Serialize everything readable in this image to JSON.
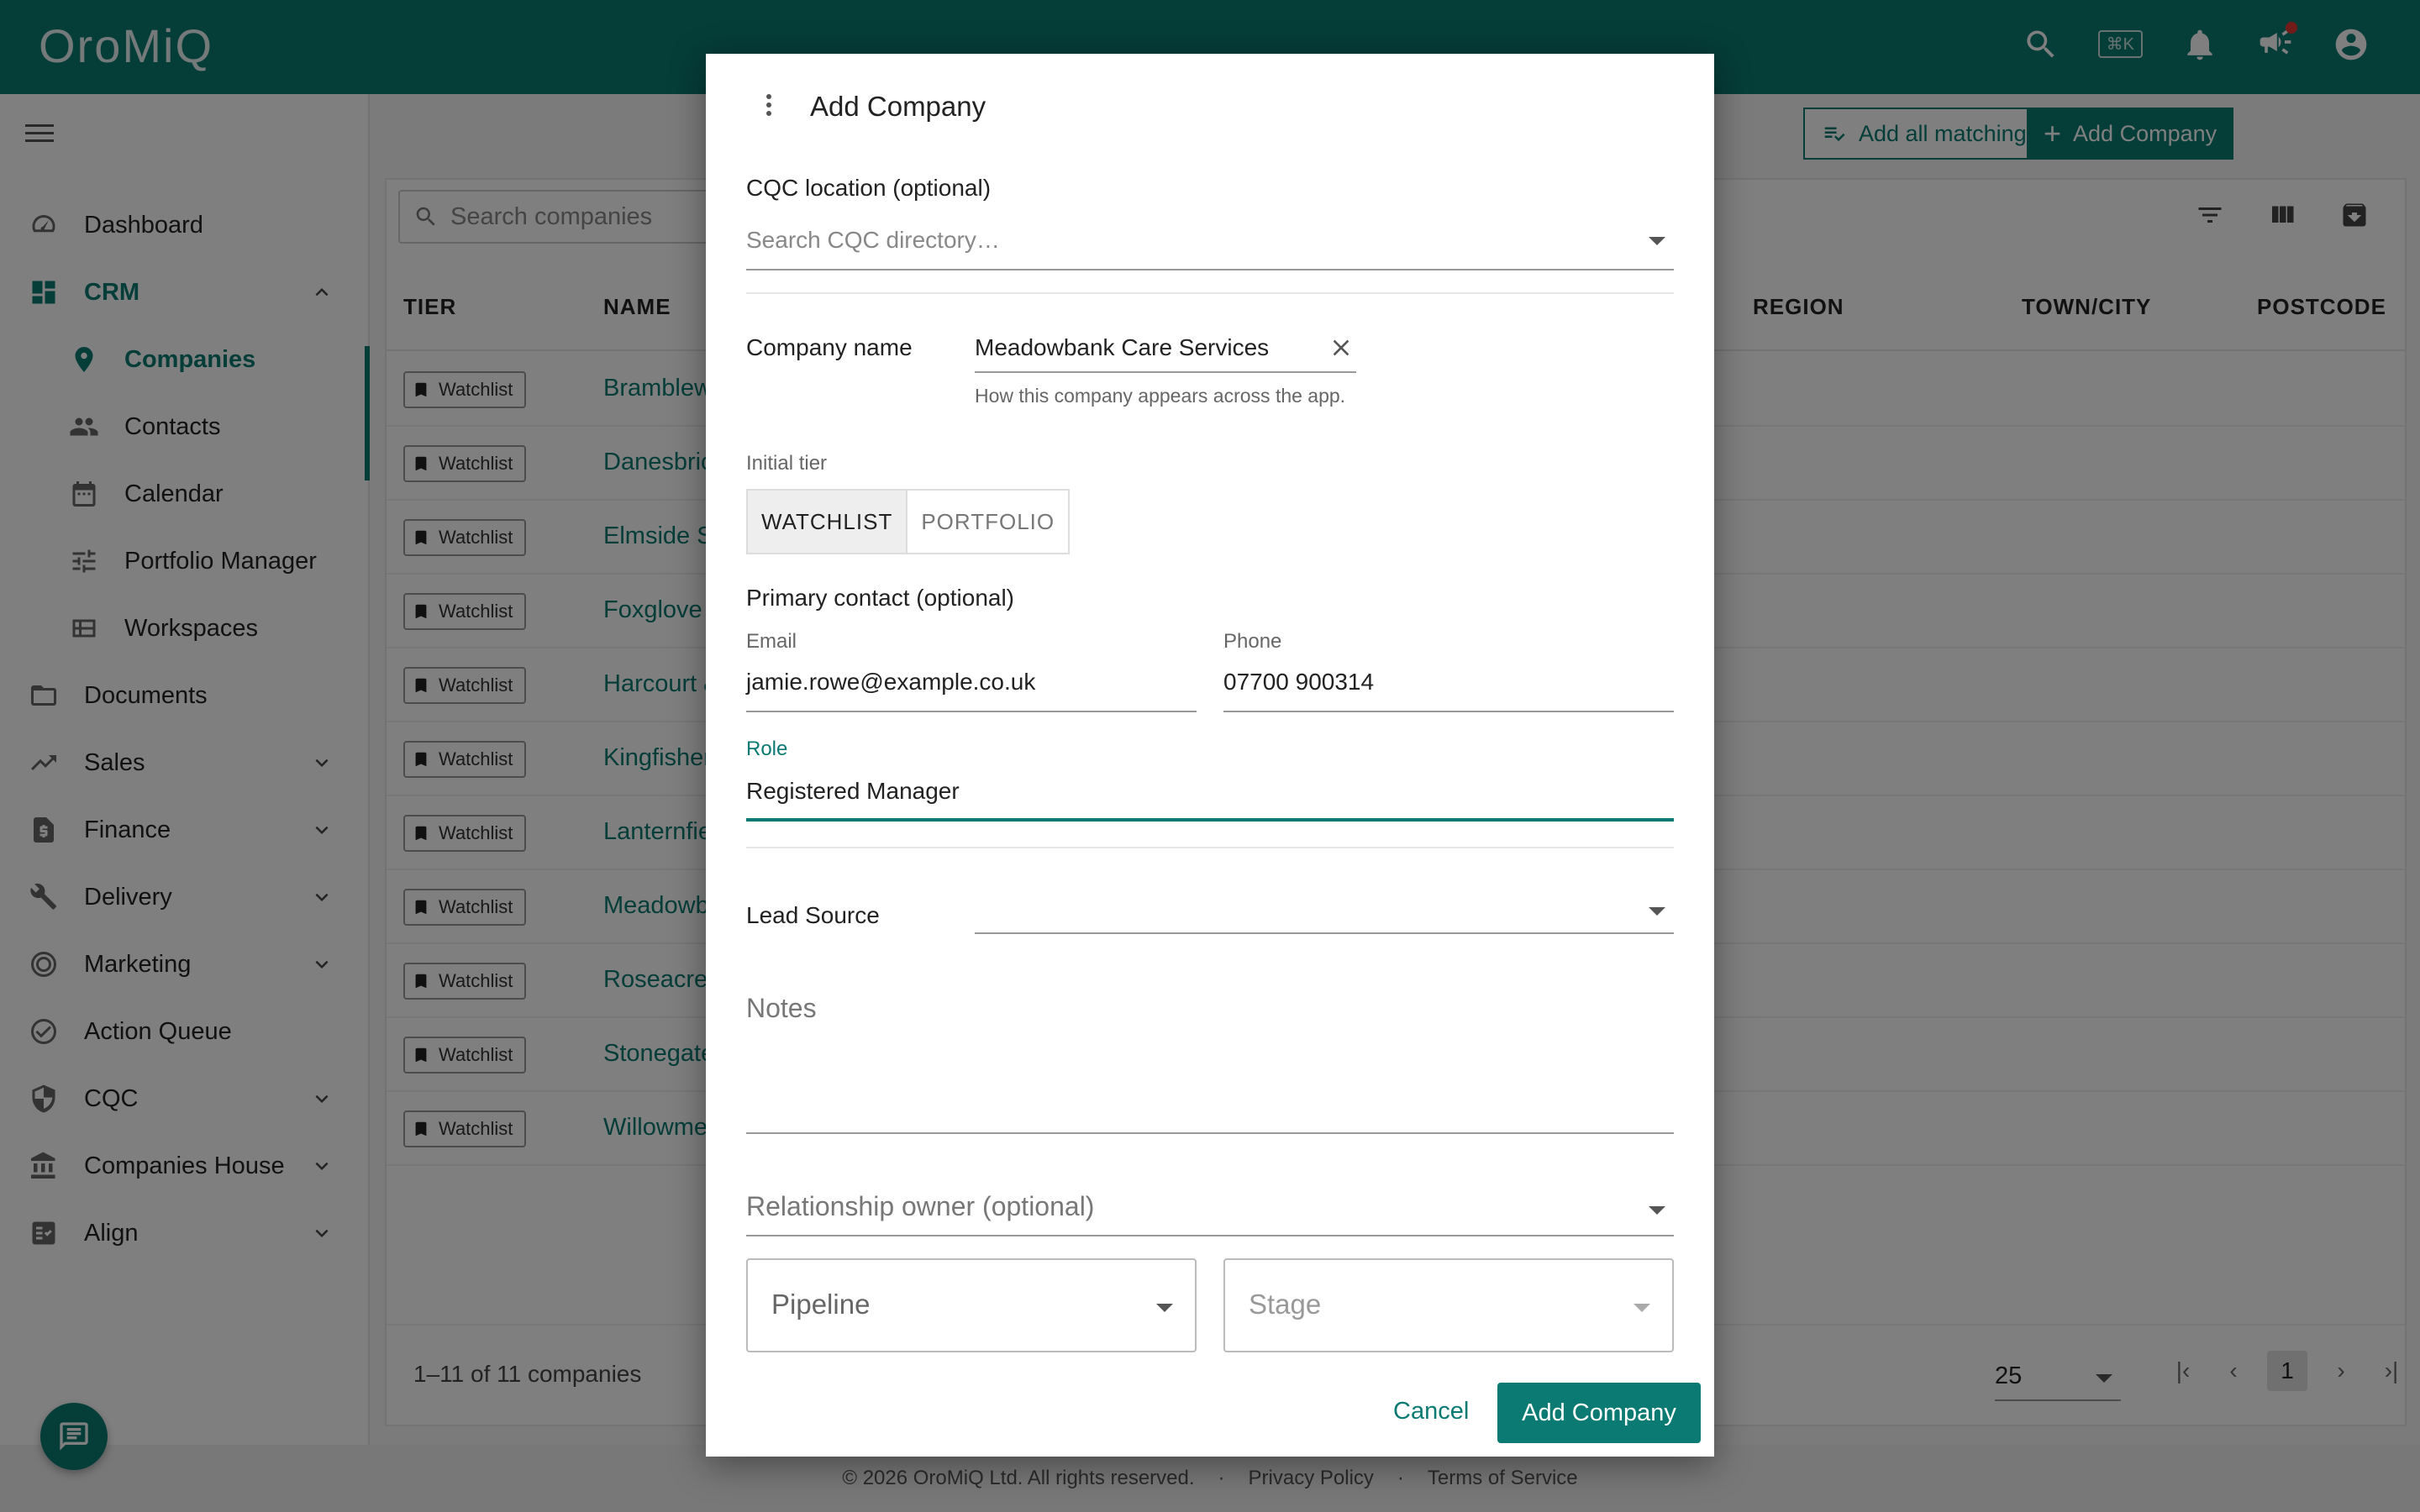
{
  "app": {
    "logo": "OroMiQ",
    "kbd_shortcut": "⌘K"
  },
  "sidebar": {
    "items": [
      {
        "label": "Dashboard",
        "icon": "speedometer-icon"
      },
      {
        "label": "CRM",
        "icon": "dashboard-grid-icon",
        "expanded": true
      },
      {
        "label": "Companies",
        "icon": "location-pin-icon",
        "active": true
      },
      {
        "label": "Contacts",
        "icon": "people-icon"
      },
      {
        "label": "Calendar",
        "icon": "calendar-icon"
      },
      {
        "label": "Portfolio Manager",
        "icon": "sliders-icon"
      },
      {
        "label": "Workspaces",
        "icon": "table-icon"
      },
      {
        "label": "Documents",
        "icon": "folder-icon"
      },
      {
        "label": "Sales",
        "icon": "trending-up-icon"
      },
      {
        "label": "Finance",
        "icon": "invoice-icon"
      },
      {
        "label": "Delivery",
        "icon": "tools-icon"
      },
      {
        "label": "Marketing",
        "icon": "target-icon"
      },
      {
        "label": "Action Queue",
        "icon": "check-circle-icon"
      },
      {
        "label": "CQC",
        "icon": "shield-icon"
      },
      {
        "label": "Companies House",
        "icon": "bank-icon"
      },
      {
        "label": "Align",
        "icon": "checklist-icon"
      }
    ]
  },
  "toolbar": {
    "add_all_label": "Add all matching → campaign",
    "add_company_label": "Add Company"
  },
  "table": {
    "search_placeholder": "Search companies",
    "columns": {
      "tier": "TIER",
      "name": "NAME",
      "region": "REGION",
      "town": "TOWN/CITY",
      "postcode": "POSTCODE"
    },
    "rows": [
      {
        "tier": "Watchlist",
        "name": "Bramblew"
      },
      {
        "tier": "Watchlist",
        "name": "Danesbric"
      },
      {
        "tier": "Watchlist",
        "name": "Elmside S"
      },
      {
        "tier": "Watchlist",
        "name": "Foxglove"
      },
      {
        "tier": "Watchlist",
        "name": "Harcourt &"
      },
      {
        "tier": "Watchlist",
        "name": "Kingfisher"
      },
      {
        "tier": "Watchlist",
        "name": "Lanternfie"
      },
      {
        "tier": "Watchlist",
        "name": "Meadowb"
      },
      {
        "tier": "Watchlist",
        "name": "Roseacre"
      },
      {
        "tier": "Watchlist",
        "name": "Stonegate"
      },
      {
        "tier": "Watchlist",
        "name": "Willowme"
      }
    ],
    "count_text": "1–11 of 11 companies",
    "per_page": "25",
    "current_page": "1"
  },
  "footer": {
    "copyright": "© 2026 OroMiQ Ltd. All rights reserved.",
    "sep": "·",
    "privacy": "Privacy Policy",
    "terms": "Terms of Service"
  },
  "modal": {
    "title": "Add Company",
    "cqc_label": "CQC location (optional)",
    "cqc_placeholder": "Search CQC directory…",
    "company_name_label": "Company name",
    "company_name_value": "Meadowbank Care Services",
    "company_name_helper": "How this company appears across the app.",
    "tier_label": "Initial tier",
    "tier_options": [
      "WATCHLIST",
      "PORTFOLIO"
    ],
    "primary_contact_label": "Primary contact (optional)",
    "email_label": "Email",
    "email_value": "jamie.rowe@example.co.uk",
    "phone_label": "Phone",
    "phone_value": "07700 900314",
    "role_label": "Role",
    "role_value": "Registered Manager",
    "lead_source_label": "Lead Source",
    "notes_placeholder": "Notes",
    "owner_placeholder": "Relationship owner (optional)",
    "pipeline_placeholder": "Pipeline",
    "stage_placeholder": "Stage",
    "cancel_label": "Cancel",
    "submit_label": "Add Company"
  },
  "colors": {
    "accent": "#0a7a72",
    "topbar": "#0a7a72"
  }
}
